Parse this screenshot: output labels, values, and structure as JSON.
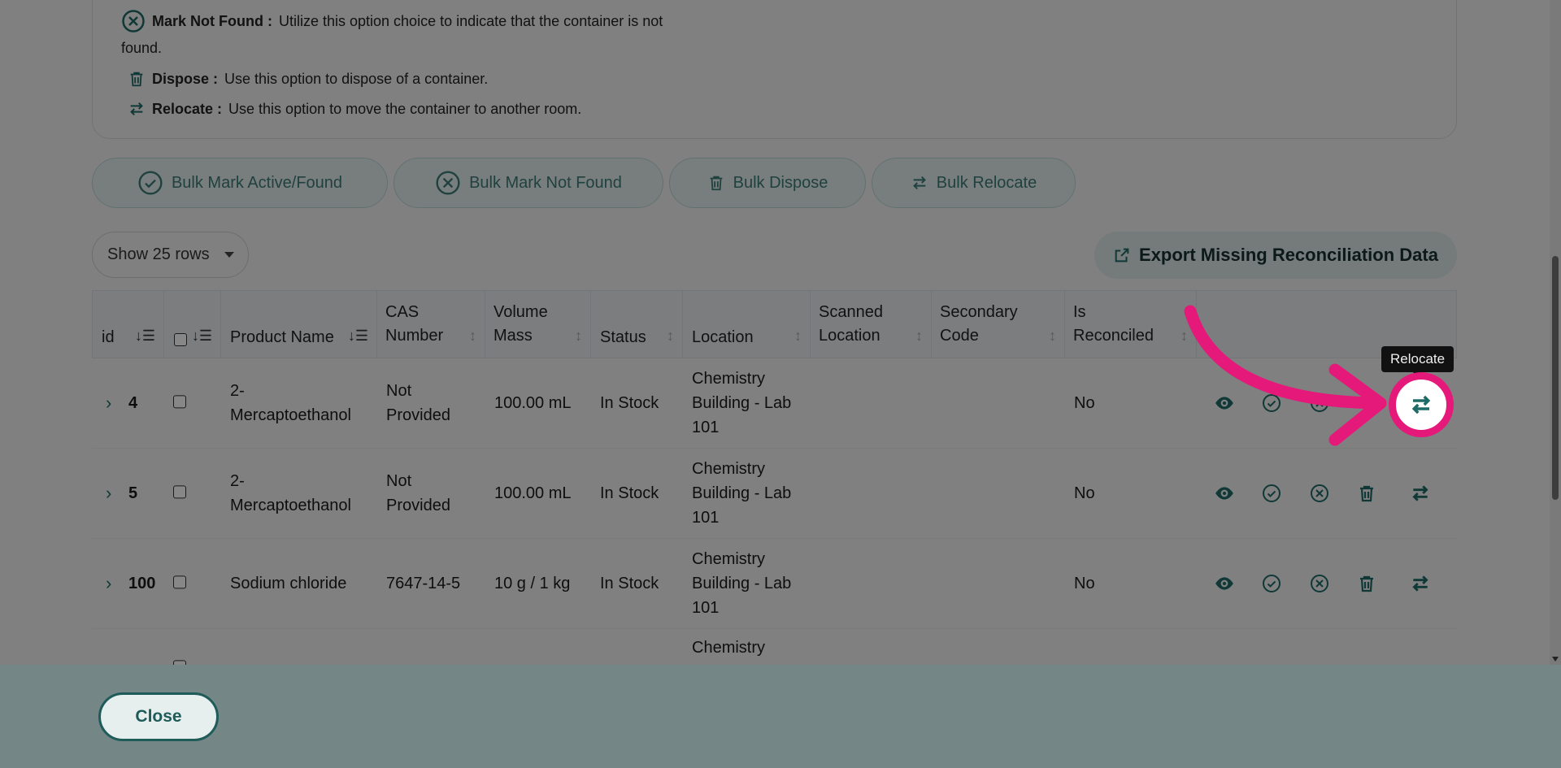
{
  "legend": {
    "not_found_label": "Mark Not Found :",
    "not_found_desc": "Utilize this option choice to indicate that the container is not",
    "not_found_desc2": "found.",
    "dispose_label": "Dispose :",
    "dispose_desc": "Use this option to dispose of a container.",
    "relocate_label": "Relocate :",
    "relocate_desc": "Use this option to move the container to another room."
  },
  "bulk_actions": {
    "mark_found": "Bulk Mark Active/Found",
    "mark_not_found": "Bulk Mark Not Found",
    "dispose": "Bulk Dispose",
    "relocate": "Bulk Relocate"
  },
  "rows_select": {
    "value": "Show 25 rows"
  },
  "export_button": "Export Missing Reconciliation Data",
  "table": {
    "headers": {
      "id": "id",
      "product_name": "Product Name",
      "cas_1": "CAS",
      "cas_2": "Number",
      "volume_1": "Volume",
      "volume_2": "Mass",
      "status": "Status",
      "location": "Location",
      "scanned_1": "Scanned",
      "scanned_2": "Location",
      "secondary_1": "Secondary",
      "secondary_2": "Code",
      "reconciled_1": "Is",
      "reconciled_2": "Reconciled"
    },
    "rows": [
      {
        "id": "4",
        "product_1": "2-",
        "product_2": "Mercaptoethanol",
        "cas_1": "Not",
        "cas_2": "Provided",
        "volume": "100.00 mL",
        "status": "In Stock",
        "loc_1": "Chemistry",
        "loc_2": "Building - Lab",
        "loc_3": "101",
        "reconciled": "No"
      },
      {
        "id": "5",
        "product_1": "2-",
        "product_2": "Mercaptoethanol",
        "cas_1": "Not",
        "cas_2": "Provided",
        "volume": "100.00 mL",
        "status": "In Stock",
        "loc_1": "Chemistry",
        "loc_2": "Building - Lab",
        "loc_3": "101",
        "reconciled": "No"
      },
      {
        "id": "100",
        "product": "Sodium chloride",
        "cas": "7647-14-5",
        "volume": "10 g / 1 kg",
        "status": "In Stock",
        "loc_1": "Chemistry",
        "loc_2": "Building - Lab",
        "loc_3": "101",
        "reconciled": "No"
      },
      {
        "loc_1": "Chemistry"
      }
    ]
  },
  "tooltip": "Relocate",
  "close_button": "Close",
  "colors": {
    "accent": "#1e6a67",
    "highlight": "#e5197a"
  }
}
